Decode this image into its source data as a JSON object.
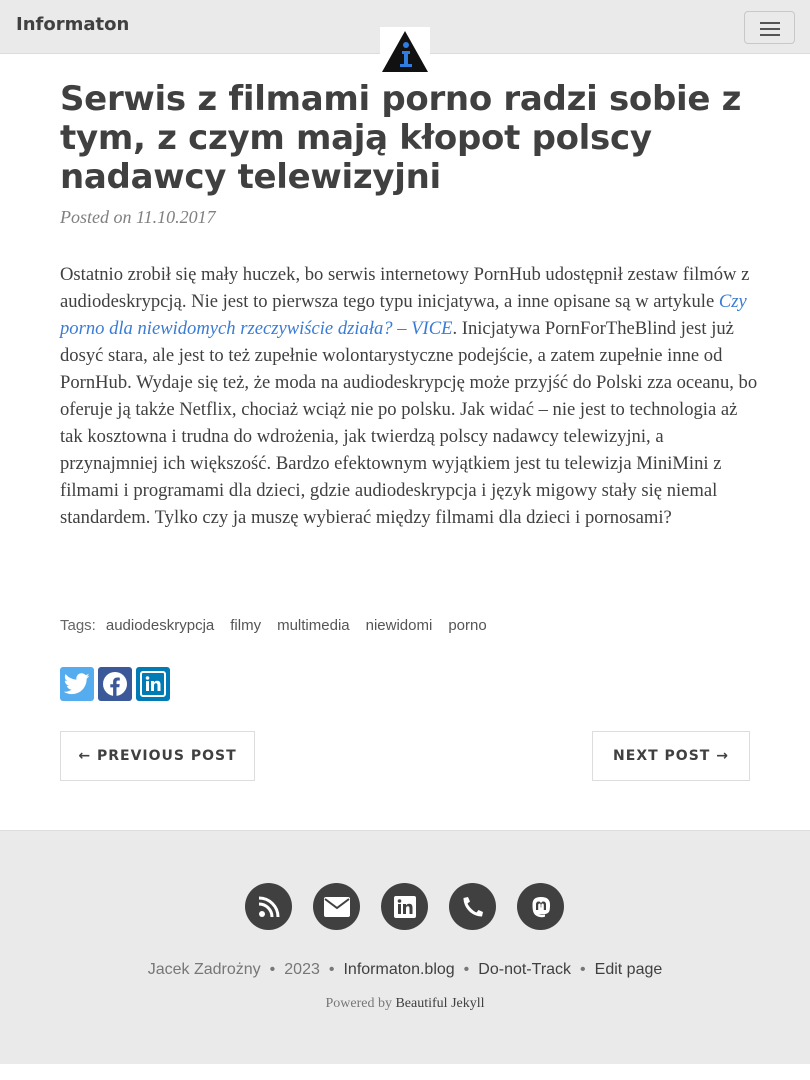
{
  "navbar": {
    "brand": "Informaton",
    "menu_icon": "hamburger-menu-icon",
    "logo_icon": "info-triangle-logo-icon"
  },
  "post": {
    "title": "Serwis z filmami porno radzi sobie z tym, z czym mają kłopot polscy nadawcy telewizyjni",
    "meta": "Posted on 11.10.2017",
    "body_before_link": "Ostatnio zrobił się mały huczek, bo serwis internetowy PornHub udostępnił zestaw filmów z audiodeskrypcją. Nie jest to pierwsza tego typu inicjatywa, a inne opisane są w artykule ",
    "link_text": "Czy porno dla niewidomych rzeczywiście działa? – VICE",
    "body_after_link": ". Inicjatywa PornForTheBlind jest już dosyć stara, ale jest to też zupełnie wolontarystyczne podejście, a zatem zupełnie inne od PornHub. Wydaje się też, że moda na audiodeskrypcję może przyjść do Polski zza oceanu, bo oferuje ją także Netflix, chociaż wciąż nie po polsku. Jak widać – nie jest to technologia aż tak kosztowna i trudna do wdrożenia, jak twierdzą polscy nadawcy telewizyjni, a przynajmniej ich większość. Bardzo efektownym wyjątkiem jest tu telewizja MiniMini z filmami i programami dla dzieci, gdzie audiodeskrypcja i język migowy stały się niemal standardem. Tylko czy ja muszę wybierać między filmami dla dzieci i pornosami?"
  },
  "tags": {
    "label": "Tags:",
    "items": [
      "audiodeskrypcja",
      "filmy",
      "multimedia",
      "niewidomi",
      "porno"
    ]
  },
  "share": {
    "icons": [
      "twitter-icon",
      "facebook-icon",
      "linkedin-icon"
    ],
    "colors": {
      "twitter": "#55acee",
      "facebook": "#3b5998",
      "linkedin": "#007bb5"
    }
  },
  "pager": {
    "previous": "← PREVIOUS POST",
    "next": "NEXT POST →"
  },
  "footer": {
    "social_icons": [
      "rss-icon",
      "email-icon",
      "linkedin-icon",
      "phone-icon",
      "mastodon-icon"
    ],
    "author": "Jacek Zadrożny",
    "year": "2023",
    "site": "Informaton.blog",
    "dnt": "Do-not-Track",
    "edit": "Edit page",
    "powered_prefix": "Powered by",
    "powered_link": "Beautiful Jekyll",
    "separator": "•"
  }
}
